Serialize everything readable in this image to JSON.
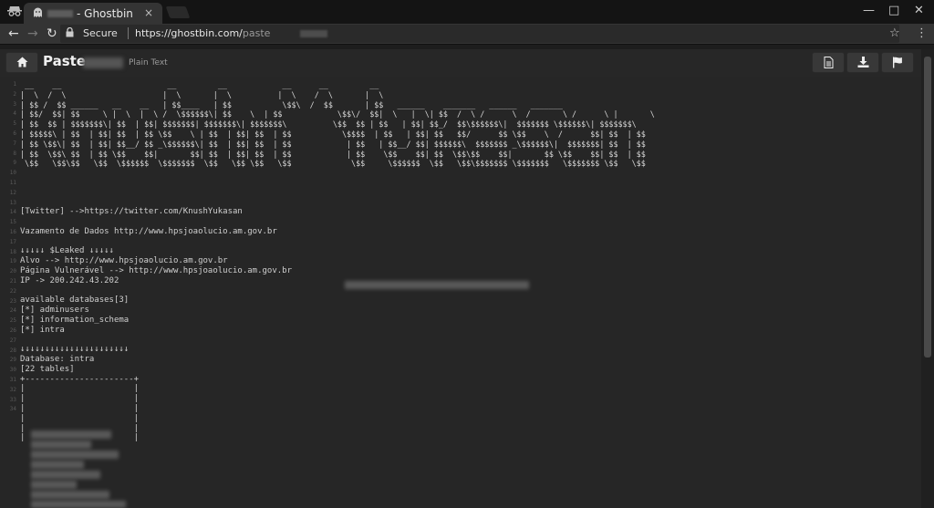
{
  "browser": {
    "tab_title": "- Ghostbin",
    "tab_close": "×",
    "secure_label": "Secure",
    "url_base": "https://ghostbin.com/",
    "url_path": "paste"
  },
  "header": {
    "title": "Paste",
    "language": "Plain Text"
  },
  "line_numbers": [
    "1",
    "2",
    "3",
    "4",
    "5",
    "6",
    "7",
    "8",
    "9",
    "10",
    "11",
    "12",
    "13",
    "14",
    "15",
    "16",
    "17",
    "18",
    "19",
    "20",
    "21",
    "22",
    "23",
    "24",
    "25",
    "26",
    "27",
    "28",
    "29",
    "30",
    "31",
    "32",
    "33",
    "34"
  ],
  "banner": [
    " __    __                       __         __            __      __         __",
    "|  \\  /  \\                     |  \\       |  \\          |  \\    /  \\       |  \\",
    "| $$ /  $$ ______   __    __   | $$____   | $$           \\$$\\  /  $$       | $$   ______    _______   ______   _______",
    "| $$/  $$| $$     \\ |  \\  |  \\ /  \\$$$$$$\\| $$    \\  | $$            \\$$\\/  $$|  \\   |  \\| $$  /  \\ /      \\  /       \\ /      \\ |       \\",
    "| $$  $$ | $$$$$$$\\| $$  | $$| $$$$$$$| $$$$$$$\\| $$$$$$$\\          \\$$  $$ | $$   | $$| $$_/  $$\\$$$$$$\\|  $$$$$$$ \\$$$$$$\\| $$$$$$$\\",
    "| $$$$$\\ | $$  | $$| $$  | $$ \\$$    \\ | $$  | $$| $$  | $$           \\$$$$  | $$   | $$| $$   $$/      $$ \\$$    \\  /      $$| $$  | $$",
    "| $$ \\$$\\| $$  | $$| $$__/ $$ _\\$$$$$$\\| $$  | $$| $$  | $$            | $$   | $$__/ $$| $$$$$$\\  $$$$$$$ _\\$$$$$$\\|  $$$$$$$| $$  | $$",
    "| $$  \\$$\\ $$  | $$ \\$$    $$|       $$| $$  | $$| $$  | $$            | $$    \\$$    $$| $$  \\$$\\$$    $$|       $$ \\$$    $$| $$  | $$",
    " \\$$   \\$$\\$$   \\$$  \\$$$$$$  \\$$$$$$$  \\$$   \\$$ \\$$   \\$$             \\$$     \\$$$$$$  \\$$   \\$$\\$$$$$$$ \\$$$$$$$   \\$$$$$$$ \\$$   \\$$"
  ],
  "lines": {
    "l11": "[Twitter] -->https://twitter.com/KnushYukasan",
    "l13": "Vazamento de Dados http://www.hpsjoaolucio.am.gov.br",
    "l15": "↓↓↓↓↓ $Leaked ↓↓↓↓↓",
    "l16": "Alvo --> http://www.hpsjoaolucio.am.gov.br",
    "l17": "Página Vulnerável --> http://www.hpsjoaolucio.am.gov.br",
    "l18": "IP -> 200.242.43.202",
    "l20": "available databases[3]",
    "l21": "[*] adminusers",
    "l22": "[*] information_schema",
    "l23": "[*] intra",
    "l25": "↓↓↓↓↓↓↓↓↓↓↓↓↓↓↓↓↓↓↓↓↓↓",
    "l26": "Database: intra",
    "l27": "[22 tables]",
    "l28": "+----------------------+",
    "l29": "|                      |",
    "l30": "|                      |",
    "l31": "|                      |",
    "l32": "|                      |",
    "l33": "|                      |",
    "l34": "|                      |"
  }
}
